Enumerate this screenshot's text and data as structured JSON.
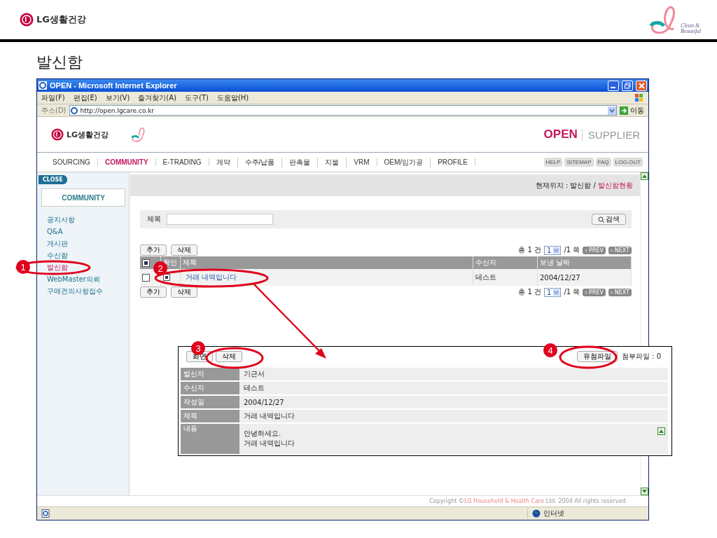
{
  "slide": {
    "logo": "LG생활건강",
    "tagline": "Clean & Beautiful",
    "title": "발신함"
  },
  "window": {
    "title": "OPEN - Microsoft Internet Explorer",
    "menu": [
      "파일(F)",
      "편집(E)",
      "보기(V)",
      "즐겨찾기(A)",
      "도구(T)",
      "도움말(H)"
    ],
    "address": {
      "label": "주소(D)",
      "url": "http://open.lgcare.co.kr",
      "go": "이동"
    },
    "status": {
      "zone": "인터넷"
    }
  },
  "site": {
    "logo": "LG생활건강",
    "brand": "OPEN",
    "brand_sub": "SUPPLIER",
    "nav": [
      {
        "label": "SOURCING",
        "selected": false
      },
      {
        "label": "COMMUNITY",
        "selected": true
      },
      {
        "label": "E-TRADING",
        "selected": false
      },
      {
        "label": "계약",
        "selected": false
      },
      {
        "label": "수주/납품",
        "selected": false
      },
      {
        "label": "판촉물",
        "selected": false
      },
      {
        "label": "지불",
        "selected": false
      },
      {
        "label": "VRM",
        "selected": false
      },
      {
        "label": "OEM/임가공",
        "selected": false
      },
      {
        "label": "PROFILE",
        "selected": false
      }
    ],
    "util_links": [
      "HELP",
      "SITEMAP",
      "FAQ",
      "LOG-OUT"
    ],
    "close_button": "CLOSE",
    "sidebar": {
      "title": "COMMUNITY",
      "items": [
        {
          "label": "공지사항",
          "selected": false
        },
        {
          "label": "Q&A",
          "selected": false
        },
        {
          "label": "게시판",
          "selected": false
        },
        {
          "label": "수신함",
          "selected": false
        },
        {
          "label": "발신함",
          "selected": true
        },
        {
          "label": "WebMaster의뢰",
          "selected": false
        },
        {
          "label": "구매건의사항접수",
          "selected": false
        }
      ]
    },
    "breadcrumb": {
      "prefix": "현재위치 : 발신함 /",
      "current": "발신함현황"
    },
    "search": {
      "label": "제목",
      "button": "검색"
    },
    "button_rows": [
      [
        "추가",
        "삭제"
      ],
      [
        "추가",
        "삭제"
      ]
    ],
    "pagers": [
      {
        "total": "총 1 건",
        "page": "1",
        "of": "/1 쪽",
        "prev": "‹ PREV",
        "next": "› NEXT"
      },
      {
        "total": "총 1 건",
        "page": "1",
        "of": "/1 쪽",
        "prev": "‹ PREV",
        "next": "› NEXT"
      }
    ],
    "table": {
      "columns": [
        "확인",
        "제목",
        "수신자",
        "보낸 날짜"
      ],
      "header_checked": true,
      "rows": [
        {
          "checked": false,
          "read": true,
          "title": "거래 내역입니다",
          "recipient": "테스트",
          "date": "2004/12/27"
        }
      ]
    },
    "copyright": {
      "prefix": "Copyright ©",
      "company": "LG Household & Health Care",
      "suffix": "Ltd. 2004 All rights reserved."
    }
  },
  "detail": {
    "buttons": [
      "화면",
      "삭제"
    ],
    "attach_button": "유첨파일",
    "attach_count": "첨부파일 : 0",
    "fields": [
      {
        "label": "발신자",
        "value": "기근서"
      },
      {
        "label": "수신자",
        "value": "테스트"
      },
      {
        "label": "작성일",
        "value": "2004/12/27"
      },
      {
        "label": "제목",
        "value": "거래 내역입니다"
      }
    ],
    "content_label": "내용",
    "content": [
      "안녕하세요.",
      "거래 내역입니다"
    ]
  },
  "annotations": [
    "1",
    "2",
    "3",
    "4"
  ]
}
